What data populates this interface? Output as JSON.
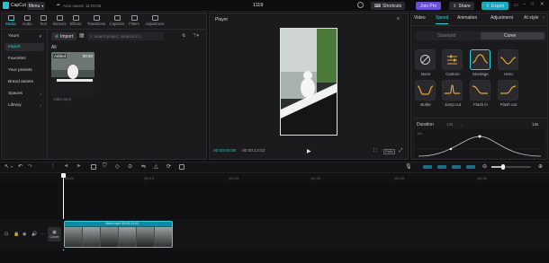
{
  "app": {
    "name": "CapCut",
    "menu_label": "Menu",
    "autosave": "Auto saved: 11:00:06",
    "project_title": "1119"
  },
  "titlebar": {
    "shortcuts": "Shortcuts",
    "join_pro": "Join Pro",
    "share": "Share",
    "export": "Export"
  },
  "media_tabs": [
    {
      "label": "Media",
      "icon": "media-icon"
    },
    {
      "label": "Audio",
      "icon": "audio-icon"
    },
    {
      "label": "Text",
      "icon": "text-icon"
    },
    {
      "label": "Stickers",
      "icon": "stickers-icon"
    },
    {
      "label": "Effects",
      "icon": "effects-icon"
    },
    {
      "label": "Transitions",
      "icon": "transitions-icon"
    },
    {
      "label": "Captions",
      "icon": "captions-icon"
    },
    {
      "label": "Filters",
      "icon": "filters-icon"
    },
    {
      "label": "Adjustment",
      "icon": "adjustment-icon"
    }
  ],
  "sidebar": {
    "items": [
      {
        "label": "Yours"
      },
      {
        "label": "Import"
      },
      {
        "label": "Favorites"
      },
      {
        "label": "Your presets"
      },
      {
        "label": "Brand assets"
      },
      {
        "label": "Spaces"
      },
      {
        "label": "Library"
      }
    ]
  },
  "media": {
    "import_label": "Import",
    "search_placeholder": "Search project, subjects in (...",
    "filter_all": "All",
    "clip_badge": "Added",
    "clip_duration": "00:20",
    "clip_name": "Video.mp4"
  },
  "player": {
    "title": "Player",
    "current_time": "00:00:00:00",
    "total_time": "00:00:13:02",
    "ratio_label": "Ratio"
  },
  "right_tabs": [
    {
      "label": "Video"
    },
    {
      "label": "Speed"
    },
    {
      "label": "Animation"
    },
    {
      "label": "Adjustment"
    },
    {
      "label": "AI style"
    }
  ],
  "speed": {
    "modes": [
      "Standard",
      "Curve"
    ],
    "effects": [
      "None",
      "Custom",
      "Montage",
      "Hero",
      "Bullet",
      "Jump cut",
      "Flash in",
      "Flash out"
    ],
    "duration_label": "Duration",
    "duration_from": "13s",
    "duration_to": "13s",
    "curve_top": "10x",
    "curve_bottom": "0.1x"
  },
  "timeline": {
    "ticks": [
      "00:00",
      "|00:10",
      "|00:20",
      "|00:30",
      "|00:40",
      "|00:50"
    ],
    "cover_label": "Cover",
    "clip_name": "Video.mp4 00:00:13:02"
  }
}
